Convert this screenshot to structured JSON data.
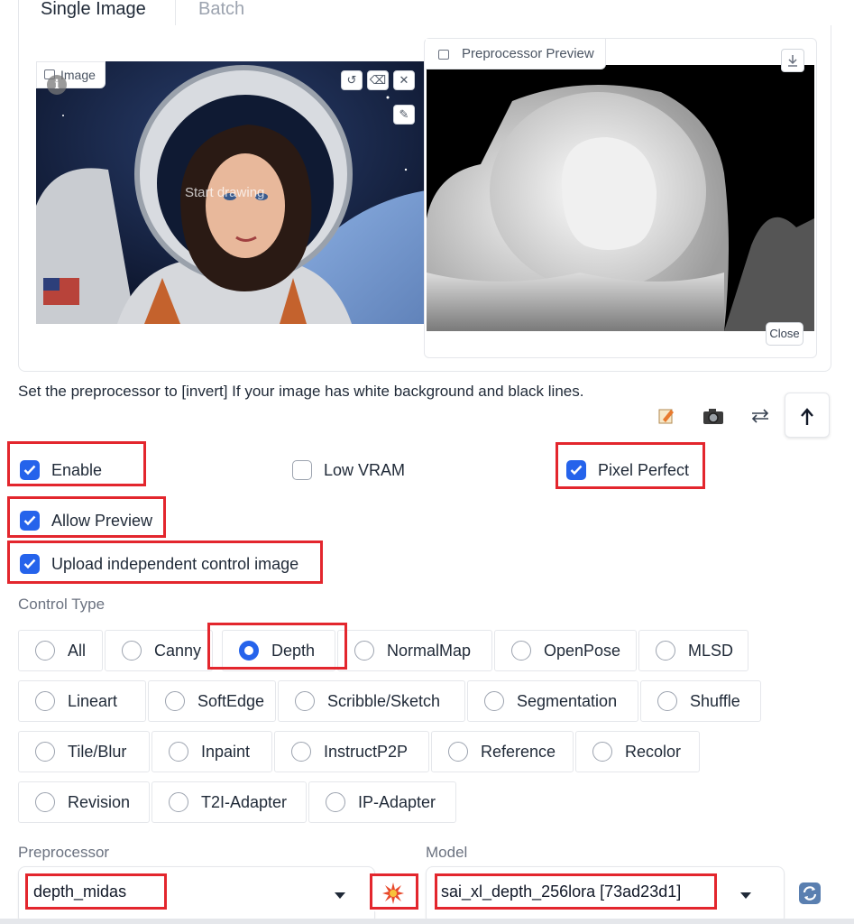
{
  "tabs": {
    "active": "Single Image",
    "inactive": "Batch"
  },
  "image_panel": {
    "label": "Image",
    "overlay_text": "Start drawing"
  },
  "preview_panel": {
    "label": "Preprocessor Preview",
    "close_label": "Close"
  },
  "hint_text": "Set the preprocessor to [invert] If your image has white background and black lines.",
  "icon_buttons": [
    "edit-icon",
    "camera-icon",
    "swap-icon",
    "send-up-icon"
  ],
  "checkboxes": {
    "enable": {
      "label": "Enable",
      "checked": true
    },
    "low_vram": {
      "label": "Low VRAM",
      "checked": false
    },
    "pixel_perfect": {
      "label": "Pixel Perfect",
      "checked": true
    },
    "allow_preview": {
      "label": "Allow Preview",
      "checked": true
    },
    "upload_independent": {
      "label": "Upload independent control image",
      "checked": true
    }
  },
  "control_type": {
    "label": "Control Type",
    "selected": "Depth",
    "options": [
      "All",
      "Canny",
      "Depth",
      "NormalMap",
      "OpenPose",
      "MLSD",
      "Lineart",
      "SoftEdge",
      "Scribble/Sketch",
      "Segmentation",
      "Shuffle",
      "Tile/Blur",
      "Inpaint",
      "InstructP2P",
      "Reference",
      "Recolor",
      "Revision",
      "T2I-Adapter",
      "IP-Adapter"
    ]
  },
  "preprocessor": {
    "label": "Preprocessor",
    "value": "depth_midas"
  },
  "model": {
    "label": "Model",
    "value": "sai_xl_depth_256lora [73ad23d1]"
  },
  "highlight_color": "#e3262d",
  "accent_color": "#2563eb"
}
